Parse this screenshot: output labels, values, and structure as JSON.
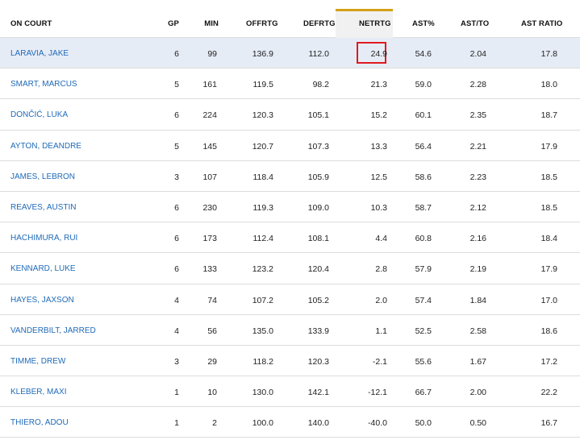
{
  "table": {
    "columns": {
      "name": "ON COURT",
      "gp": "GP",
      "min": "MIN",
      "offrtg": "OFFRTG",
      "defrtg": "DEFRTG",
      "netrtg": "NETRTG",
      "ast_pct": "AST%",
      "ast_to": "AST/TO",
      "ast_ratio": "AST RATIO"
    },
    "sorted_column": "NETRTG",
    "sort_indicator_color": "#d4a017",
    "highlight_box_color": "#e0191e",
    "link_color": "#1f6ab8",
    "rows": [
      {
        "name": "LARAVIA, JAKE",
        "gp": "6",
        "min": "99",
        "offrtg": "136.9",
        "defrtg": "112.0",
        "netrtg": "24.9",
        "ast_pct": "54.6",
        "ast_to": "2.04",
        "ast_ratio": "17.8"
      },
      {
        "name": "SMART, MARCUS",
        "gp": "5",
        "min": "161",
        "offrtg": "119.5",
        "defrtg": "98.2",
        "netrtg": "21.3",
        "ast_pct": "59.0",
        "ast_to": "2.28",
        "ast_ratio": "18.0"
      },
      {
        "name": "DONČIĆ, LUKA",
        "gp": "6",
        "min": "224",
        "offrtg": "120.3",
        "defrtg": "105.1",
        "netrtg": "15.2",
        "ast_pct": "60.1",
        "ast_to": "2.35",
        "ast_ratio": "18.7"
      },
      {
        "name": "AYTON, DEANDRE",
        "gp": "5",
        "min": "145",
        "offrtg": "120.7",
        "defrtg": "107.3",
        "netrtg": "13.3",
        "ast_pct": "56.4",
        "ast_to": "2.21",
        "ast_ratio": "17.9"
      },
      {
        "name": "JAMES, LEBRON",
        "gp": "3",
        "min": "107",
        "offrtg": "118.4",
        "defrtg": "105.9",
        "netrtg": "12.5",
        "ast_pct": "58.6",
        "ast_to": "2.23",
        "ast_ratio": "18.5"
      },
      {
        "name": "REAVES, AUSTIN",
        "gp": "6",
        "min": "230",
        "offrtg": "119.3",
        "defrtg": "109.0",
        "netrtg": "10.3",
        "ast_pct": "58.7",
        "ast_to": "2.12",
        "ast_ratio": "18.5"
      },
      {
        "name": "HACHIMURA, RUI",
        "gp": "6",
        "min": "173",
        "offrtg": "112.4",
        "defrtg": "108.1",
        "netrtg": "4.4",
        "ast_pct": "60.8",
        "ast_to": "2.16",
        "ast_ratio": "18.4"
      },
      {
        "name": "KENNARD, LUKE",
        "gp": "6",
        "min": "133",
        "offrtg": "123.2",
        "defrtg": "120.4",
        "netrtg": "2.8",
        "ast_pct": "57.9",
        "ast_to": "2.19",
        "ast_ratio": "17.9"
      },
      {
        "name": "HAYES, JAXSON",
        "gp": "4",
        "min": "74",
        "offrtg": "107.2",
        "defrtg": "105.2",
        "netrtg": "2.0",
        "ast_pct": "57.4",
        "ast_to": "1.84",
        "ast_ratio": "17.0"
      },
      {
        "name": "VANDERBILT, JARRED",
        "gp": "4",
        "min": "56",
        "offrtg": "135.0",
        "defrtg": "133.9",
        "netrtg": "1.1",
        "ast_pct": "52.5",
        "ast_to": "2.58",
        "ast_ratio": "18.6"
      },
      {
        "name": "TIMME, DREW",
        "gp": "3",
        "min": "29",
        "offrtg": "118.2",
        "defrtg": "120.3",
        "netrtg": "-2.1",
        "ast_pct": "55.6",
        "ast_to": "1.67",
        "ast_ratio": "17.2"
      },
      {
        "name": "KLEBER, MAXI",
        "gp": "1",
        "min": "10",
        "offrtg": "130.0",
        "defrtg": "142.1",
        "netrtg": "-12.1",
        "ast_pct": "66.7",
        "ast_to": "2.00",
        "ast_ratio": "22.2"
      },
      {
        "name": "THIERO, ADOU",
        "gp": "1",
        "min": "2",
        "offrtg": "100.0",
        "defrtg": "140.0",
        "netrtg": "-40.0",
        "ast_pct": "50.0",
        "ast_to": "0.50",
        "ast_ratio": "16.7"
      }
    ]
  }
}
